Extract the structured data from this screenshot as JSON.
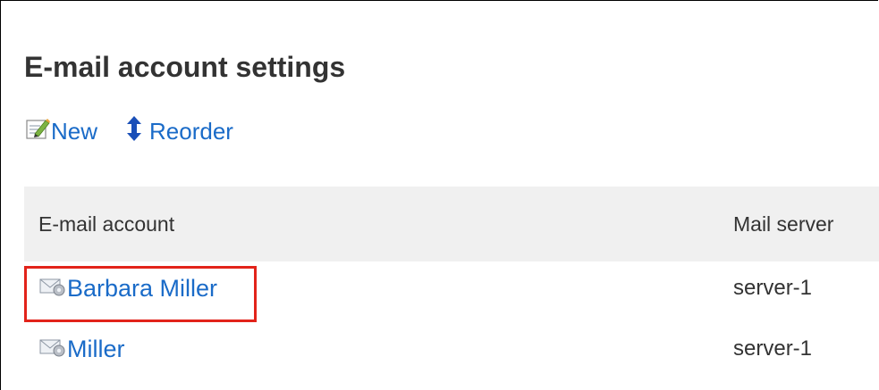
{
  "page": {
    "title": "E-mail account settings"
  },
  "toolbar": {
    "new_label": "New",
    "new_icon": "new-document-pencil-icon",
    "reorder_label": "Reorder",
    "reorder_icon": "reorder-arrows-icon"
  },
  "table": {
    "columns": [
      "E-mail account",
      "Mail server"
    ],
    "rows": [
      {
        "account": "Barbara Miller",
        "server": "server-1",
        "highlighted": true,
        "icon": "mail-settings-icon"
      },
      {
        "account": "Miller",
        "server": "server-1",
        "highlighted": false,
        "icon": "mail-settings-icon"
      }
    ]
  },
  "colors": {
    "link": "#1a6bc8",
    "text": "#333333",
    "header_bg": "#f0f0f0",
    "highlight_border": "#e2231a"
  }
}
